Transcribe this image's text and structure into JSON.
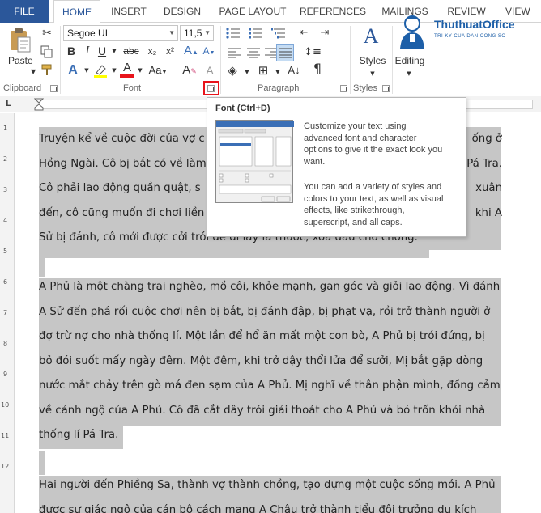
{
  "tabs": [
    "FILE",
    "HOME",
    "INSERT",
    "DESIGN",
    "PAGE LAYOUT",
    "REFERENCES",
    "MAILINGS",
    "REVIEW",
    "VIEW"
  ],
  "active_tab": "HOME",
  "ribbon": {
    "clipboard": {
      "label": "Clipboard",
      "paste_label": "Paste"
    },
    "font": {
      "label": "Font",
      "font_name": "Segoe UI",
      "font_size": "11,5"
    },
    "paragraph": {
      "label": "Paragraph"
    },
    "styles": {
      "label": "Styles",
      "styles_button": "Styles"
    },
    "editing": {
      "label": "Editing"
    }
  },
  "logo": {
    "title": "ThuthuatOffice",
    "subtitle": "TRI KY CUA DAN CONG SO"
  },
  "tooltip": {
    "title": "Font (Ctrl+D)",
    "description_1": [
      "Customize your text using",
      "advanced font and character",
      "options to give it the exact look you",
      "want."
    ],
    "description_2": [
      "You can add a variety of styles and",
      "colors to your text, as well as visual",
      "effects, like strikethrough,",
      "superscript, and all caps."
    ]
  },
  "document": {
    "paragraph_1": [
      "Truyện kể về cuộc đời của vợ c",
      "Hồng Ngài. Cô bị bắt có về làm",
      "Cô phải lao động quần quật, s",
      "đến, cô cũng muốn đi chơi liền",
      "Sử bị đánh, cô mới được cởi trói để đi lấy lá thuốc, xoa dầu cho chồng."
    ],
    "paragraph_1_right": [
      "ống ở",
      "Pá Tra.",
      "xuân",
      "khi A",
      ""
    ],
    "paragraph_2": [
      "A Phủ là một chàng trai nghèo, mồ côi, khỏe mạnh, gan góc và giỏi lao động. Vì đánh",
      "A Sử đến phá rối cuộc chơi nên bị bắt, bị đánh đập, bị phạt vạ, rồi trở thành người ở",
      "đợ trừ nợ cho nhà thống lí. Một lần để hổ ăn mất một con bò, A Phủ bị trói đứng, bị",
      "bỏ đói suốt mấy ngày đêm. Một đêm, khi trở dậy thổi lửa để sưởi, Mị bắt gặp dòng",
      "nước mắt chảy trên gò má đen sạm của A Phủ. Mị nghĩ về thân phận mình, đồng cảm",
      "về cảnh ngộ của A Phủ. Cô đã cắt dây trói giải thoát cho A Phủ và bỏ trốn khỏi nhà",
      "thống lí Pá Tra."
    ],
    "paragraph_3": [
      "Hai người đến Phiềng Sa, thành vợ thành chồng, tạo dựng một cuộc sống mới. A Phủ",
      "được sự giác ngộ của cán bộ cách mạng A Châu trở thành tiểu đội trưởng du kích"
    ]
  },
  "ruler": {
    "vertical_numbers": [
      "1",
      "2",
      "3",
      "4",
      "5",
      "6",
      "7",
      "8",
      "9",
      "10",
      "11",
      "12"
    ]
  },
  "colors": {
    "file_tab": "#2b579a",
    "selection": "#c6c6c6",
    "highlight_box": "#e8141b",
    "logo": "#1d5fa8"
  }
}
